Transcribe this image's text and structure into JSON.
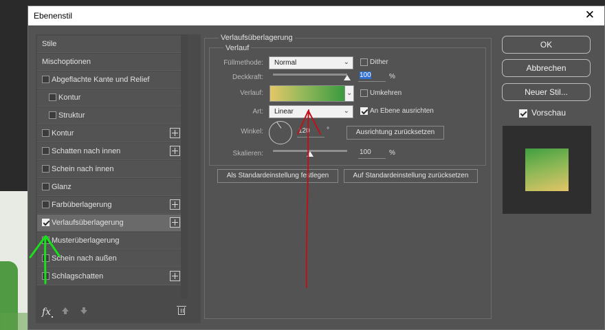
{
  "window": {
    "title": "Ebenenstil",
    "close_glyph": "✕"
  },
  "styles_list": {
    "header": "Stile",
    "items": [
      {
        "label": "Mischoptionen",
        "checkbox": false,
        "checked": false,
        "plus": false,
        "indent": false
      },
      {
        "label": "Abgeflachte Kante und Relief",
        "checkbox": true,
        "checked": false,
        "plus": false,
        "indent": false
      },
      {
        "label": "Kontur",
        "checkbox": true,
        "checked": false,
        "plus": false,
        "indent": true
      },
      {
        "label": "Struktur",
        "checkbox": true,
        "checked": false,
        "plus": false,
        "indent": true
      },
      {
        "label": "Kontur",
        "checkbox": true,
        "checked": false,
        "plus": true,
        "indent": false
      },
      {
        "label": "Schatten nach innen",
        "checkbox": true,
        "checked": false,
        "plus": true,
        "indent": false
      },
      {
        "label": "Schein nach innen",
        "checkbox": true,
        "checked": false,
        "plus": false,
        "indent": false
      },
      {
        "label": "Glanz",
        "checkbox": true,
        "checked": false,
        "plus": false,
        "indent": false
      },
      {
        "label": "Farbüberlagerung",
        "checkbox": true,
        "checked": false,
        "plus": true,
        "indent": false
      },
      {
        "label": "Verlaufsüberlagerung",
        "checkbox": true,
        "checked": true,
        "plus": true,
        "indent": false,
        "selected": true
      },
      {
        "label": "Musterüberlagerung",
        "checkbox": true,
        "checked": false,
        "plus": false,
        "indent": false
      },
      {
        "label": "Schein nach außen",
        "checkbox": true,
        "checked": false,
        "plus": false,
        "indent": false
      },
      {
        "label": "Schlagschatten",
        "checkbox": true,
        "checked": false,
        "plus": true,
        "indent": false
      }
    ],
    "footer": {
      "fx_label": "fx"
    }
  },
  "panel": {
    "group_title": "Verlaufsüberlagerung",
    "subgroup_title": "Verlauf",
    "fuellmethode": {
      "label": "Füllmethode:",
      "value": "Normal"
    },
    "dither": {
      "label": "Dither",
      "checked": false
    },
    "deckkraft": {
      "label": "Deckkraft:",
      "value": "100",
      "unit": "%",
      "level": 1.0
    },
    "verlauf": {
      "label": "Verlauf:",
      "colors": [
        "#e3c768",
        "#3a9a3f"
      ]
    },
    "umkehren": {
      "label": "Umkehren",
      "checked": false
    },
    "art": {
      "label": "Art:",
      "value": "Linear"
    },
    "an_ebene": {
      "label": "An Ebene ausrichten",
      "checked": true
    },
    "winkel": {
      "label": "Winkel:",
      "value": "120",
      "unit": "°"
    },
    "ausrichtung_btn": "Ausrichtung zurücksetzen",
    "skalieren": {
      "label": "Skalieren:",
      "value": "100",
      "unit": "%",
      "level": 0.5
    },
    "default_set_btn": "Als Standardeinstellung festlegen",
    "default_reset_btn": "Auf Standardeinstellung zurücksetzen"
  },
  "actions": {
    "ok": "OK",
    "cancel": "Abbrechen",
    "new_style": "Neuer Stil...",
    "preview_label": "Vorschau",
    "preview_checked": true
  },
  "colors": {
    "annotation_red": "#c0101a",
    "annotation_green": "#19e01a"
  }
}
